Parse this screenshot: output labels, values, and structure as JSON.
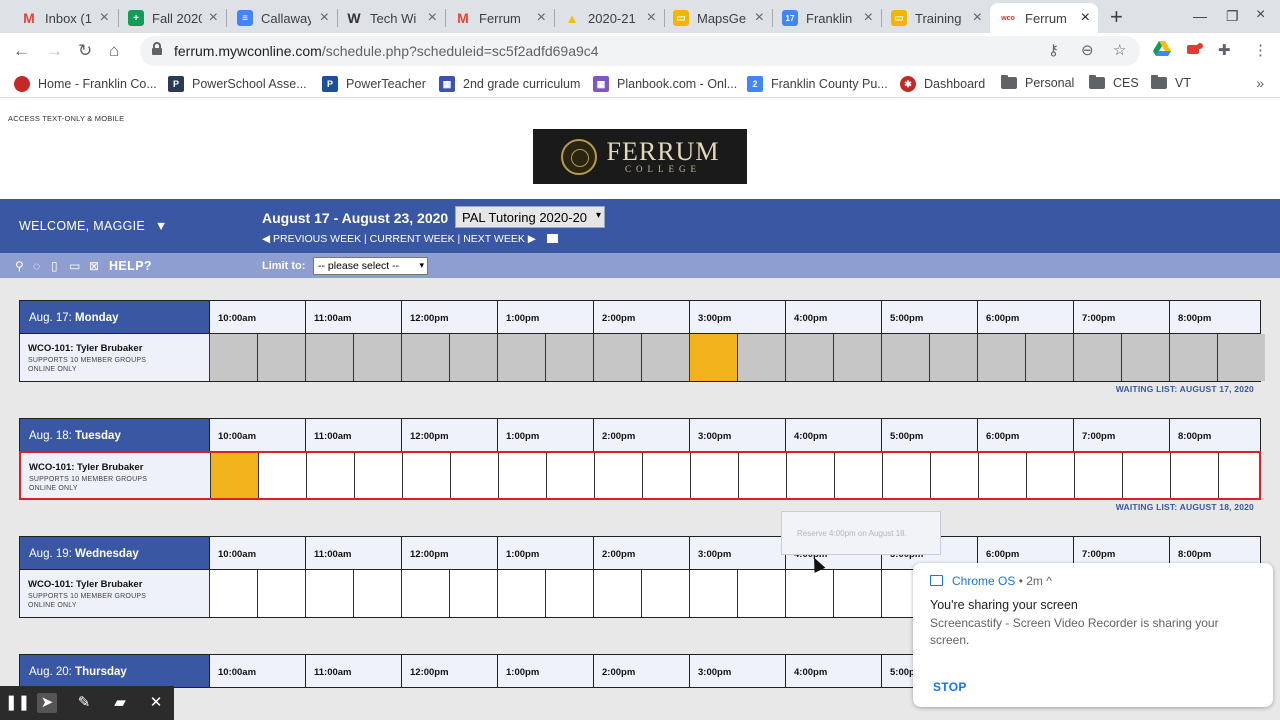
{
  "tabs": [
    {
      "label": "Inbox (1",
      "icon": "gmail-icon",
      "color": "#ea4335",
      "glyph": "M"
    },
    {
      "label": "Fall 2020",
      "icon": "sheets-icon",
      "color": "#0f9d58",
      "glyph": "+"
    },
    {
      "label": "Callaway",
      "icon": "docs-icon",
      "color": "#4285f4",
      "glyph": "≡"
    },
    {
      "label": "Tech Wi",
      "icon": "wordpress-icon",
      "color": "#333333",
      "glyph": "W"
    },
    {
      "label": "Ferrum",
      "icon": "gmail-icon",
      "color": "#ea4335",
      "glyph": "M"
    },
    {
      "label": "2020-21",
      "icon": "drive-icon",
      "color": "#fbbc04",
      "glyph": "▲"
    },
    {
      "label": "MapsGe",
      "icon": "slides-icon",
      "color": "#f4b400",
      "glyph": "▭"
    },
    {
      "label": "Franklin",
      "icon": "calendar-icon",
      "color": "#4285f4",
      "glyph": "17"
    },
    {
      "label": "Training",
      "icon": "slides-icon",
      "color": "#f4b400",
      "glyph": "▭"
    },
    {
      "label": "Ferrum",
      "icon": "wco-icon",
      "color": "#d93025",
      "glyph": "wco"
    }
  ],
  "url": {
    "host": "ferrum.mywconline.com",
    "path": "/schedule.php?scheduleid=sc5f2adfd69a9c4"
  },
  "bookmarks": [
    {
      "label": "Home - Franklin Co...",
      "icon": "franklin-icon",
      "color": "#c62828"
    },
    {
      "label": "PowerSchool Asse...",
      "icon": "powerschool-icon",
      "color": "#2b3a55"
    },
    {
      "label": "PowerTeacher",
      "icon": "powerteacher-icon",
      "color": "#1f4e9c"
    },
    {
      "label": "2nd grade curriculum",
      "icon": "calendar-grid-icon",
      "color": "#3f51b5"
    },
    {
      "label": "Planbook.com - Onl...",
      "icon": "planbook-icon",
      "color": "#7e57c2"
    },
    {
      "label": "Franklin County Pu...",
      "icon": "calendar-icon",
      "color": "#4285f4"
    },
    {
      "label": "Dashboard",
      "icon": "dashboard-icon",
      "color": "#c62828"
    },
    {
      "label": "Personal",
      "icon": "folder-icon"
    },
    {
      "label": "CES",
      "icon": "folder-icon"
    },
    {
      "label": "VT",
      "icon": "folder-icon"
    }
  ],
  "page": {
    "access_link": "ACCESS TEXT-ONLY & MOBILE",
    "logo": {
      "big": "FERRUM",
      "small": "COLLEGE"
    },
    "welcome": "WELCOME, MAGGIE",
    "date_range": "August 17 - August 23, 2020",
    "schedule_select": "PAL Tutoring 2020-20",
    "nav": {
      "previous": "◀ PREVIOUS WEEK",
      "current": "CURRENT WEEK",
      "next": "NEXT WEEK ▶"
    },
    "help": "HELP?",
    "limit_label": "Limit to:",
    "limit_value": "-- please select --"
  },
  "times": [
    "10:00am",
    "11:00am",
    "12:00pm",
    "1:00pm",
    "2:00pm",
    "3:00pm",
    "4:00pm",
    "5:00pm",
    "6:00pm",
    "7:00pm",
    "8:00pm"
  ],
  "days": [
    {
      "date": "Aug. 17:",
      "day": "Monday",
      "waiting": "WAITING LIST: AUGUST 17, 2020"
    },
    {
      "date": "Aug. 18:",
      "day": "Tuesday",
      "waiting": "WAITING LIST: AUGUST 18, 2020"
    },
    {
      "date": "Aug. 19:",
      "day": "Wednesday",
      "waiting": ""
    },
    {
      "date": "Aug. 20:",
      "day": "Thursday",
      "waiting": ""
    }
  ],
  "resource": {
    "name": "WCO-101: Tyler Brubaker",
    "line1": "SUPPORTS 10 MEMBER GROUPS",
    "line2": "ONLINE ONLY"
  },
  "tooltip": "Reserve 4:00pm on August 18.",
  "notification": {
    "source": "Chrome OS",
    "ago": "• 2m ^",
    "title": "You're sharing your screen",
    "body": "Screencastify - Screen Video Recorder is sharing your screen.",
    "action": "STOP"
  },
  "colors": {
    "brand": "#3a57a4",
    "booked": "#f2b21b",
    "closed": "#c6c6c6",
    "selected_border": "#d9212a"
  }
}
